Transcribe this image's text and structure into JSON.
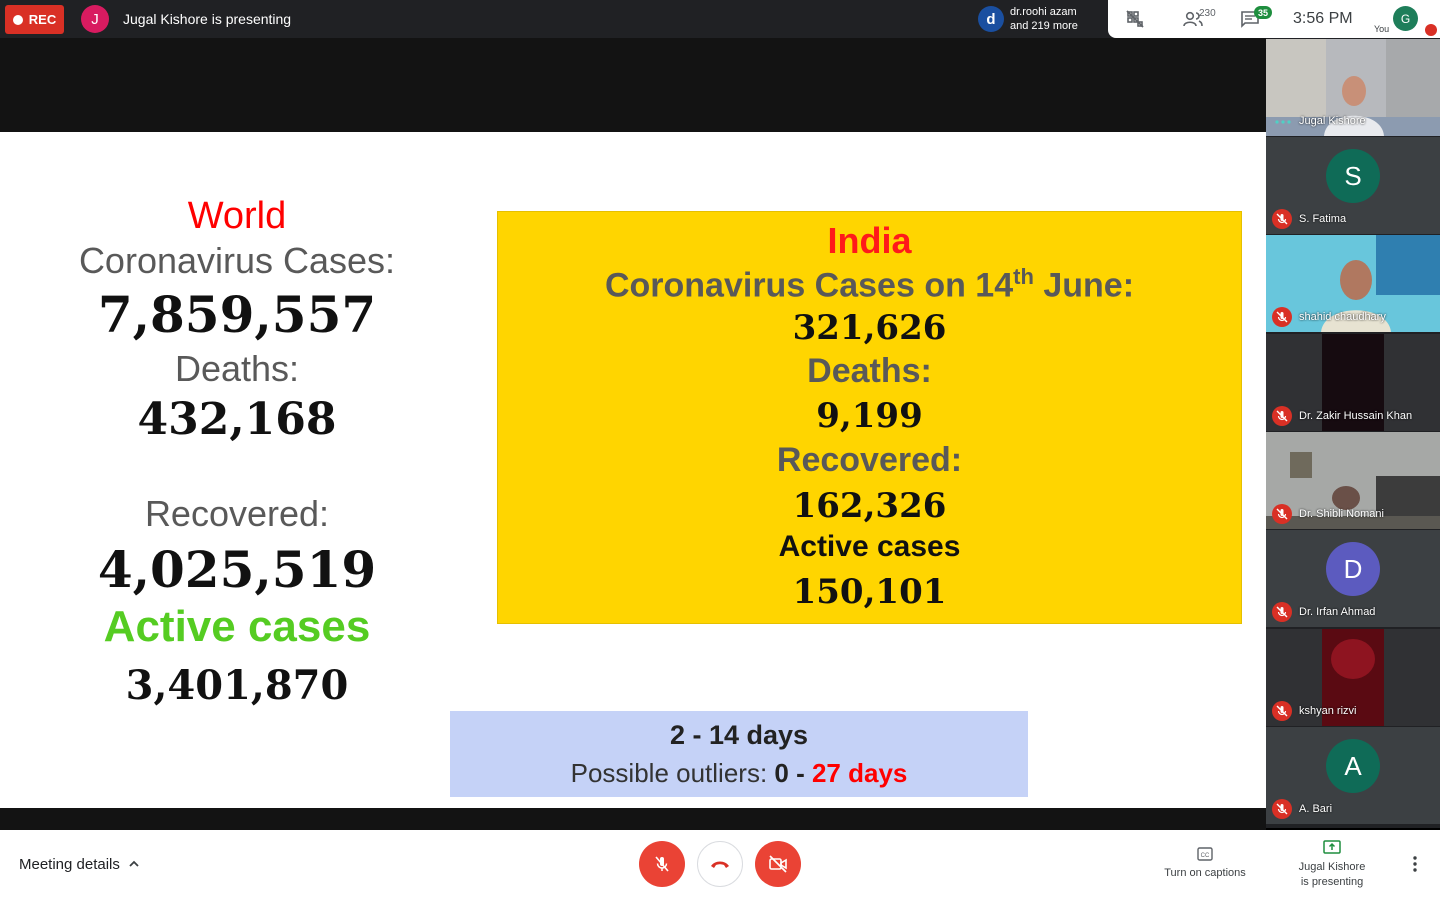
{
  "topbar": {
    "rec_label": "REC",
    "presenter_initial": "J",
    "presenter_text": "Jugal Kishore is presenting",
    "others_initial": "d",
    "others_line1": "dr.roohi azam",
    "others_line2": "and 219 more",
    "people_count": "230",
    "chat_count": "35",
    "time": "3:56  PM",
    "you_label": "You",
    "self_initial": "G"
  },
  "slide": {
    "world": {
      "title": "World",
      "cases_label": "Coronavirus Cases:",
      "cases_value": "7,859,557",
      "deaths_label": "Deaths:",
      "deaths_value": "432,168",
      "recovered_label": "Recovered:",
      "recovered_value": "4,025,519",
      "active_label": "Active cases",
      "active_value": "3,401,870"
    },
    "india": {
      "title": "India",
      "cases_label_prefix": "Coronavirus Cases on 14",
      "cases_label_sup": "th",
      "cases_label_suffix": " June:",
      "cases_value": "321,626",
      "deaths_label": "Deaths:",
      "deaths_value": "9,199",
      "recovered_label": "Recovered:",
      "recovered_value": "162,326",
      "active_label": "Active cases",
      "active_value": "150,101"
    },
    "incubation": {
      "line1": "2 - 14 days",
      "line2_prefix": "Possible outliers: ",
      "line2_zero": "0 -",
      "line2_red": " 27 days"
    }
  },
  "participants": [
    {
      "name": "Jugal Kishore",
      "initial": "",
      "avatar_color": "",
      "muted": false
    },
    {
      "name": "S. Fatima",
      "initial": "S",
      "avatar_color": "#0f6b57",
      "muted": true
    },
    {
      "name": "shahid chaudhary",
      "initial": "",
      "avatar_color": "",
      "muted": true
    },
    {
      "name": "Dr. Zakir Hussain Khan",
      "initial": "",
      "avatar_color": "",
      "muted": true
    },
    {
      "name": "Dr. Shibli Nomani",
      "initial": "",
      "avatar_color": "",
      "muted": true
    },
    {
      "name": "Dr. Irfan Ahmad",
      "initial": "D",
      "avatar_color": "#5c5bbf",
      "muted": true
    },
    {
      "name": "kshyan rizvi",
      "initial": "",
      "avatar_color": "",
      "muted": true
    },
    {
      "name": "A. Bari",
      "initial": "A",
      "avatar_color": "#0f6b57",
      "muted": true
    }
  ],
  "bottombar": {
    "meeting_details": "Meeting details",
    "captions_label": "Turn on captions",
    "present_line1": "Jugal Kishore",
    "present_line2": "is presenting"
  },
  "colors": {
    "rec_red": "#d93025",
    "control_red": "#ea4335",
    "india_box_yellow": "#ffd500",
    "days_box_blue": "#c5d2f7",
    "active_green": "#55cc22",
    "chat_badge_green": "#1e8e3e"
  },
  "icons": [
    "record-dot-icon",
    "grid-off-icon",
    "people-icon",
    "chat-icon",
    "mic-off-icon",
    "hangup-icon",
    "camera-off-icon",
    "captions-icon",
    "present-screen-icon",
    "more-vert-icon",
    "chevron-up-icon",
    "speaking-dots-icon"
  ]
}
